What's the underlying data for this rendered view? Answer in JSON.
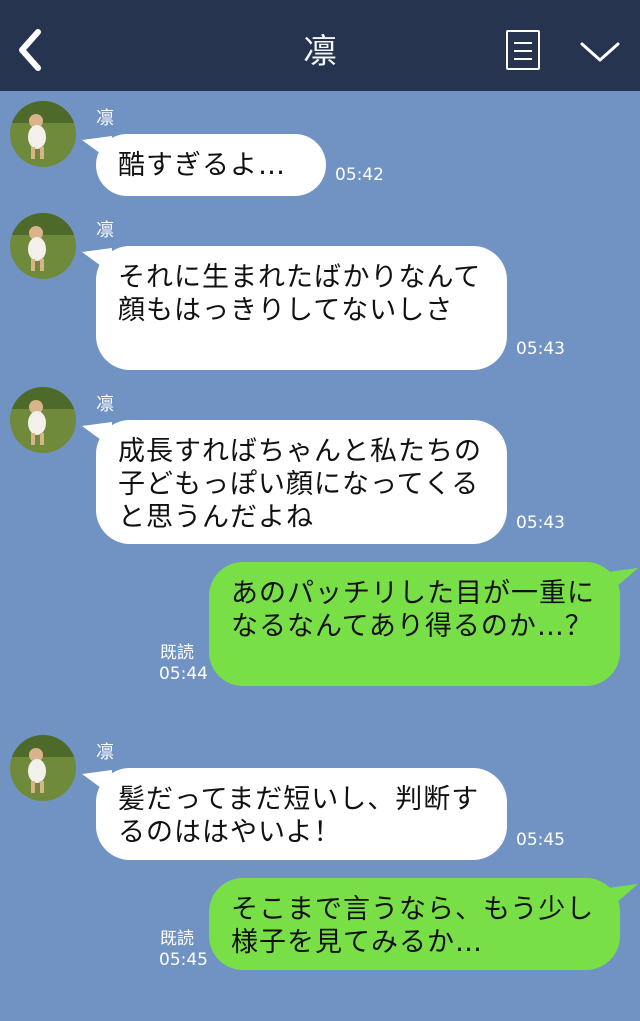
{
  "header": {
    "title": "凛"
  },
  "messages": [
    {
      "from": "them",
      "name": "凛",
      "text": "酷すぎるよ…",
      "time": "05:42"
    },
    {
      "from": "them",
      "name": "凛",
      "text": "それに生まれたばかりなんて顔もはっきりしてないしさ",
      "time": "05:43"
    },
    {
      "from": "them",
      "name": "凛",
      "text": "成長すればちゃんと私たちの子どもっぽい顔になってくると思うんだよね",
      "time": "05:43"
    },
    {
      "from": "me",
      "read": "既読",
      "text": "あのパッチリした目が一重になるなんてあり得るのか…？",
      "time": "05:44"
    },
    {
      "from": "them",
      "name": "凛",
      "text": "髪だってまだ短いし、判断するのははやいよ！",
      "time": "05:45"
    },
    {
      "from": "me",
      "read": "既読",
      "text": "そこまで言うなら、もう少し様子を見てみるか…",
      "time": "05:45"
    }
  ]
}
